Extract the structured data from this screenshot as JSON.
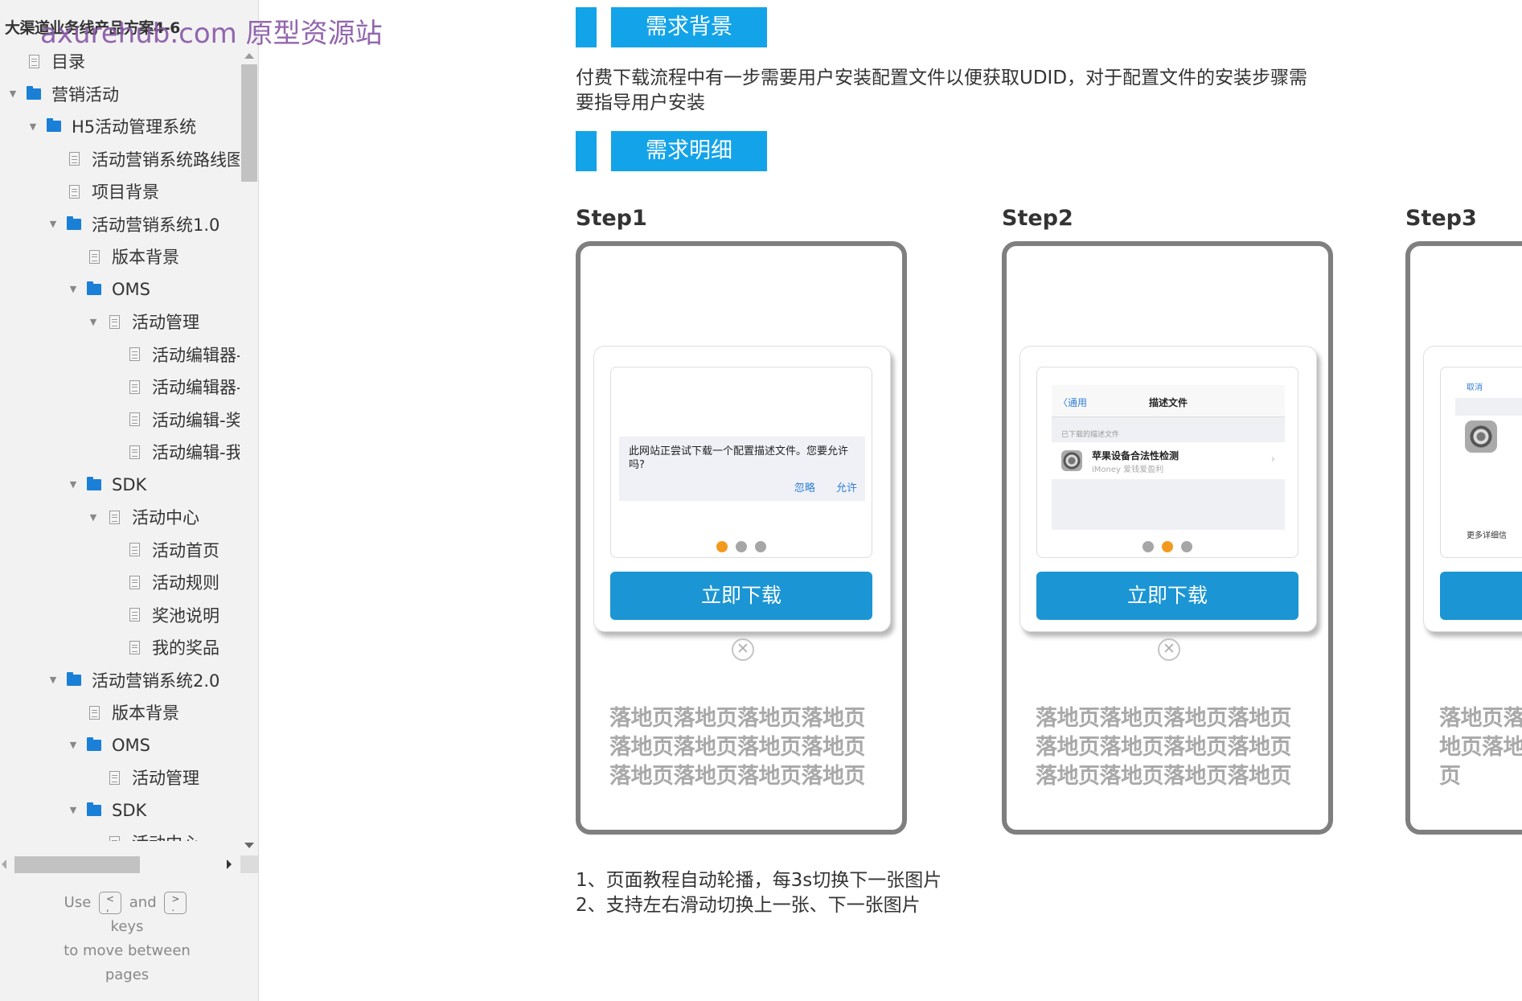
{
  "sidebar": {
    "project_title": "大渠道业务线产品方案4-6",
    "watermark": "axurehub.com 原型资源站",
    "tree": [
      {
        "label": "目录",
        "type": "page",
        "level": 0,
        "expanded": null
      },
      {
        "label": "营销活动",
        "type": "folder",
        "level": 0,
        "expanded": true
      },
      {
        "label": "H5活动管理系统",
        "type": "folder",
        "level": 1,
        "expanded": true
      },
      {
        "label": "活动营销系统路线图",
        "type": "page",
        "level": 2,
        "expanded": null
      },
      {
        "label": "项目背景",
        "type": "page",
        "level": 2,
        "expanded": null
      },
      {
        "label": "活动营销系统1.0",
        "type": "folder",
        "level": 2,
        "expanded": true
      },
      {
        "label": "版本背景",
        "type": "page",
        "level": 3,
        "expanded": null
      },
      {
        "label": "OMS",
        "type": "folder",
        "level": 3,
        "expanded": true
      },
      {
        "label": "活动管理",
        "type": "page",
        "level": 4,
        "expanded": true
      },
      {
        "label": "活动编辑器-",
        "type": "page",
        "level": 5,
        "expanded": null
      },
      {
        "label": "活动编辑器-",
        "type": "page",
        "level": 5,
        "expanded": null
      },
      {
        "label": "活动编辑-奖",
        "type": "page",
        "level": 5,
        "expanded": null
      },
      {
        "label": "活动编辑-我",
        "type": "page",
        "level": 5,
        "expanded": null
      },
      {
        "label": "SDK",
        "type": "folder",
        "level": 3,
        "expanded": true
      },
      {
        "label": "活动中心",
        "type": "page",
        "level": 4,
        "expanded": true
      },
      {
        "label": "活动首页",
        "type": "page",
        "level": 5,
        "expanded": null
      },
      {
        "label": "活动规则",
        "type": "page",
        "level": 5,
        "expanded": null
      },
      {
        "label": "奖池说明",
        "type": "page",
        "level": 5,
        "expanded": null
      },
      {
        "label": "我的奖品",
        "type": "page",
        "level": 5,
        "expanded": null
      },
      {
        "label": "活动营销系统2.0",
        "type": "folder",
        "level": 2,
        "expanded": true
      },
      {
        "label": "版本背景",
        "type": "page",
        "level": 3,
        "expanded": null
      },
      {
        "label": "OMS",
        "type": "folder",
        "level": 3,
        "expanded": true
      },
      {
        "label": "活动管理",
        "type": "page",
        "level": 4,
        "expanded": null
      },
      {
        "label": "SDK",
        "type": "folder",
        "level": 3,
        "expanded": true
      },
      {
        "label": "活动中心",
        "type": "page",
        "level": 4,
        "expanded": null
      }
    ],
    "nav_hint": {
      "use": "Use",
      "key_prev": "<\n,",
      "and": "and",
      "key_next": ">\n.",
      "keys": "keys",
      "to_move": "to move between",
      "pages": "pages"
    }
  },
  "main": {
    "section_background": {
      "label": "需求背景"
    },
    "description": "付费下载流程中有一步需要用户安装配置文件以便获取UDID，对于配置文件的安装步骤需要指导用户安装",
    "section_detail": {
      "label": "需求明细"
    },
    "steps": [
      {
        "label": "Step1",
        "active_dot": 0,
        "alert_text": "此网站正尝试下载一个配置描述文件。您要允许吗?",
        "alert_ignore": "忽略",
        "alert_allow": "允许",
        "download_button": "立即下载",
        "landing_text": "落地页落地页落地页落地页落地页落地页落地页落地页落地页落地页落地页落地页"
      },
      {
        "label": "Step2",
        "active_dot": 1,
        "nav_back": "〈通用",
        "nav_title": "描述文件",
        "section_caption": "已下载的描述文件",
        "profile_name": "苹果设备合法性检测",
        "profile_sub": "iMoney 爱钱爱盈利",
        "download_button": "立即下载",
        "landing_text": "落地页落地页落地页落地页落地页落地页落地页落地页落地页落地页落地页落地页"
      },
      {
        "label": "Step3",
        "cancel": "取消",
        "more_details": "更多详细信",
        "landing_text": "落地页落地页落地页"
      }
    ],
    "notes": [
      "1、页面教程自动轮播，每3s切换下一张图片",
      "2、支持左右滑动切换上一张、下一张图片"
    ]
  },
  "colors": {
    "accent": "#13a3e8",
    "button": "#1b95d3",
    "dot_active": "#f39a1e",
    "dot_inactive": "#a6a6a6",
    "folder": "#1a7fd6",
    "watermark": "#8a5aa8"
  }
}
